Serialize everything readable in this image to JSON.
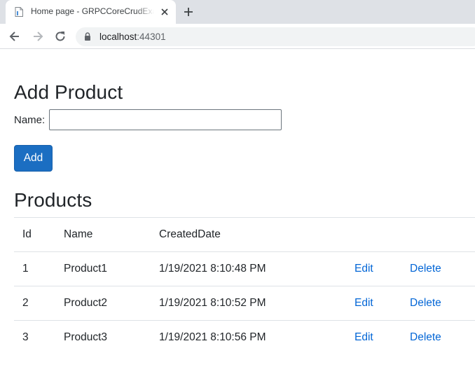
{
  "browser": {
    "tab_title": "Home page - GRPCCoreCrudExample",
    "url_host": "localhost",
    "url_port": ":44301"
  },
  "add_section": {
    "heading": "Add Product",
    "name_label": "Name:",
    "name_value": "",
    "add_button": "Add"
  },
  "products_section": {
    "heading": "Products",
    "columns": [
      "Id",
      "Name",
      "CreatedDate"
    ],
    "rows": [
      {
        "id": "1",
        "name": "Product1",
        "created": "1/19/2021 8:10:48 PM",
        "edit": "Edit",
        "delete": "Delete"
      },
      {
        "id": "2",
        "name": "Product2",
        "created": "1/19/2021 8:10:52 PM",
        "edit": "Edit",
        "delete": "Delete"
      },
      {
        "id": "3",
        "name": "Product3",
        "created": "1/19/2021 8:10:56 PM",
        "edit": "Edit",
        "delete": "Delete"
      }
    ]
  },
  "colors": {
    "primary": "#1b6ec2",
    "link": "#0366d6",
    "tabstrip": "#dee1e6"
  }
}
